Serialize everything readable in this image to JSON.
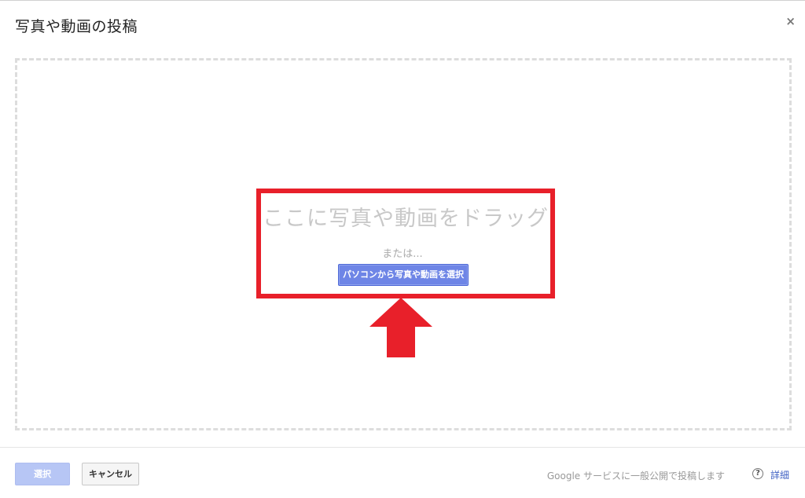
{
  "dialog": {
    "title": "写真や動画の投稿",
    "close_icon": "close-icon",
    "close_glyph": "×"
  },
  "dropzone": {
    "drag_text": "ここに写真や動画をドラッグ",
    "or_text": "または...",
    "choose_button_label": "パソコンから写真や動画を選択",
    "highlight_color": "#e8202a",
    "arrow_icon": "up-arrow-icon",
    "arrow_color": "#e8202a"
  },
  "footer": {
    "select_label": "選択",
    "cancel_label": "キャンセル",
    "notice": "Google サービスに一般公開で投稿します",
    "help_icon": "question-circle-icon",
    "help_glyph": "?",
    "details_label": "詳細"
  },
  "colors": {
    "primary_button": "#6e85e6",
    "disabled_button": "#b7c6f5",
    "link": "#4062c4"
  }
}
